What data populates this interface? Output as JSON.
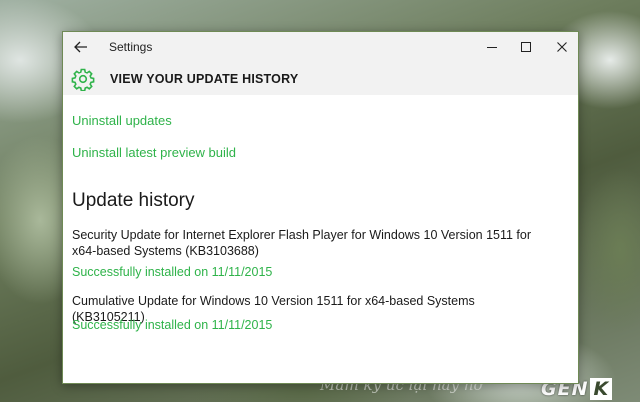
{
  "window": {
    "title": "Settings",
    "page_title": "VIEW YOUR UPDATE HISTORY"
  },
  "links": {
    "uninstall_updates": "Uninstall updates",
    "uninstall_preview": "Uninstall latest preview build"
  },
  "history": {
    "heading": "Update history",
    "items": [
      {
        "name": "Security Update for Internet Explorer Flash Player for Windows 10 Version 1511 for x64-based Systems (KB3103688)",
        "status": "Successfully installed on 11/11/2015"
      },
      {
        "name": "Cumulative Update for Windows 10 Version 1511 for x64-based Systems (KB3105211)",
        "status": "Successfully installed on 11/11/2015"
      }
    ]
  },
  "background": {
    "caption": "Mầm ký ức lại nảy nở",
    "logo_main": "GEN",
    "logo_k": "K"
  },
  "colors": {
    "accent": "#2fb34a",
    "titlebar": "#f2f2f2",
    "window_border": "#6f8a55"
  },
  "icons": {
    "back": "arrow-left-icon",
    "settings": "gear-icon",
    "minimize": "minimize-icon",
    "maximize": "maximize-icon",
    "close": "close-icon"
  }
}
